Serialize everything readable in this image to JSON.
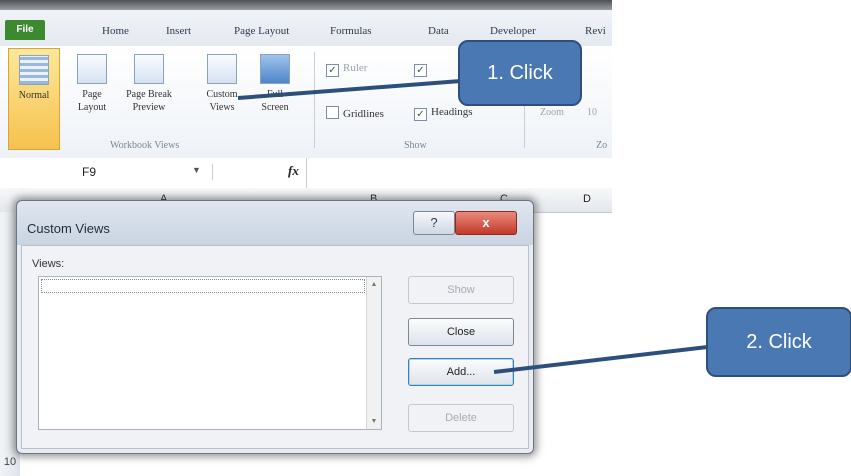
{
  "ribbon_tabs": {
    "file": "File",
    "home": "Home",
    "insert": "Insert",
    "page_layout": "Page Layout",
    "formulas": "Formulas",
    "data": "Data",
    "developer": "Developer",
    "review": "Revi"
  },
  "workbook_views": {
    "normal": "Normal",
    "page_layout": [
      "Page",
      "Layout"
    ],
    "page_break": [
      "Page Break",
      "Preview"
    ],
    "custom_views": [
      "Custom",
      "Views"
    ],
    "full_screen": [
      "Full",
      "Screen"
    ],
    "group_label": "Workbook Views"
  },
  "show_group": {
    "ruler": "Ruler",
    "gridlines": "Gridlines",
    "headings": "Headings",
    "group_label": "Show",
    "ruler_checked": true,
    "gridlines_checked": false,
    "headings_checked": true
  },
  "zoom_group": {
    "zoom": "Zoom",
    "hundred": "10",
    "group_label": "Zo"
  },
  "formula_bar": {
    "name_box": "F9",
    "fx": "fx"
  },
  "column_headers": {
    "a": "A",
    "b": "B",
    "c": "C",
    "d": "D"
  },
  "row_numbers": [
    "10"
  ],
  "dialog": {
    "title": "Custom Views",
    "help": "?",
    "close_x": "x",
    "views_label": "Views:",
    "views": [],
    "buttons": {
      "show": "Show",
      "close": "Close",
      "add": "Add...",
      "delete": "Delete"
    }
  },
  "callouts": {
    "step1": "1. Click",
    "step2": "2. Click"
  },
  "colors": {
    "accent": "#4a78b3",
    "file_tab": "#3b8a2f",
    "selected_button": "#f6c14d"
  }
}
